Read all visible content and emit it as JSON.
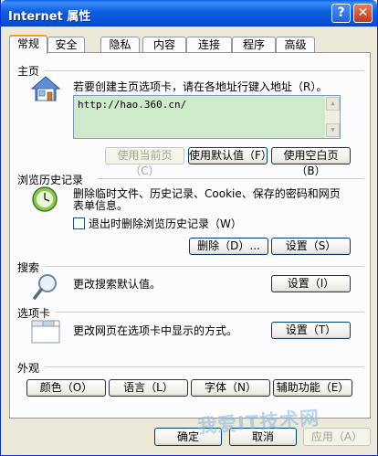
{
  "window": {
    "title": "Internet 属性",
    "help_label": "?",
    "close_label": "✕"
  },
  "tabs": [
    {
      "label": "常规",
      "active": true
    },
    {
      "label": "安全"
    },
    {
      "label": "隐私"
    },
    {
      "label": "内容"
    },
    {
      "label": "连接"
    },
    {
      "label": "程序"
    },
    {
      "label": "高级"
    }
  ],
  "homepage": {
    "section_title": "主页",
    "instruction": "若要创建主页选项卡，请在各地址行键入地址（R）。",
    "url_value": "http://hao.360.cn/",
    "use_current": "使用当前页（C）",
    "use_default": "使用默认值（F）",
    "use_blank": "使用空白页（B）",
    "icon": "house-icon"
  },
  "history": {
    "section_title": "浏览历史记录",
    "description_line1": "删除临时文件、历史记录、Cookie、保存的密码和网页",
    "description_line2": "表单信息。",
    "checkbox_label": "退出时删除浏览历史记录（W）",
    "checkbox_checked": false,
    "delete_button": "删除（D）...",
    "settings_button": "设置（S）",
    "icon": "history-clock-icon"
  },
  "search": {
    "section_title": "搜索",
    "description": "更改搜索默认值。",
    "settings_button": "设置（I）",
    "icon": "magnifier-icon"
  },
  "tabs_section": {
    "section_title": "选项卡",
    "description": "更改网页在选项卡中显示的方式。",
    "settings_button": "设置（T）",
    "icon": "tabbed-window-icon"
  },
  "appearance": {
    "section_title": "外观",
    "colors_button": "颜色（O）",
    "languages_button": "语言（L）",
    "fonts_button": "字体（N）",
    "accessibility_button": "辅助功能（E）"
  },
  "footer": {
    "ok_button": "确定",
    "cancel_button": "取消",
    "apply_button": "应用（A）"
  },
  "watermark": "我爱IT技术网"
}
